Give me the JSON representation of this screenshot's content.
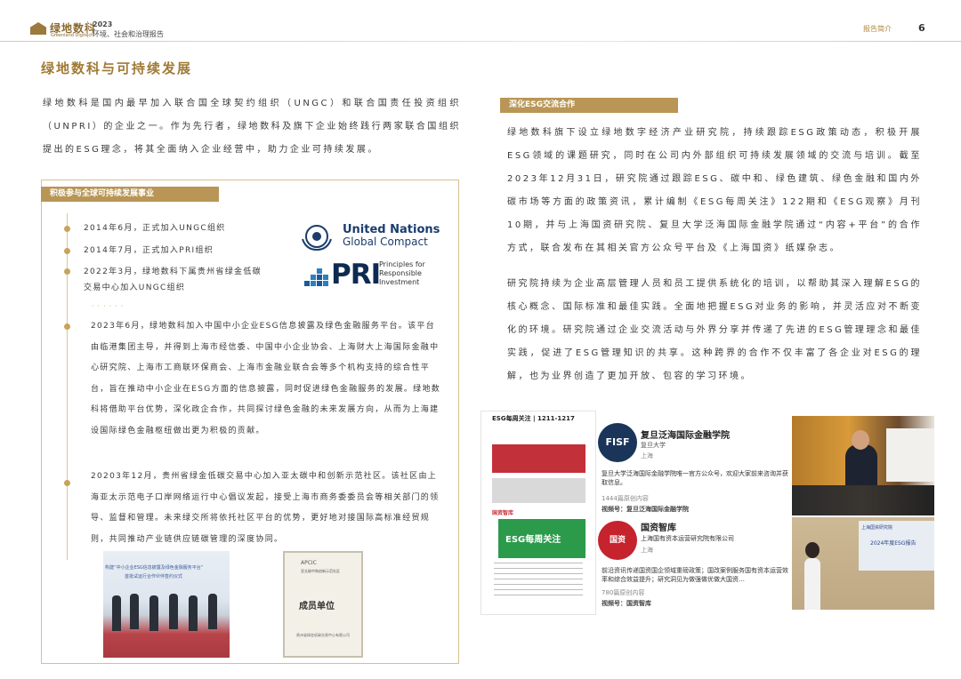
{
  "header": {
    "logo_cn": "绿地数科",
    "logo_en": "Greenland Digitech",
    "year": "2023",
    "report_title": "环境、社会和治理报告",
    "section": "报告简介",
    "page": "6"
  },
  "title": "绿地数科与可持续发展",
  "intro": "绿地数科是国内最早加入联合国全球契约组织（UNGC）和联合国责任投资组织（UNPRI）的企业之一。作为先行者，绿地数科及旗下企业始终践行两家联合国组织提出的ESG理念，将其全面纳入企业经营中，助力企业可持续发展。",
  "left_box": {
    "tag": "积极参与全球可持续发展事业",
    "timeline": [
      "2014年6月，正式加入UNGC组织",
      "2014年7月，正式加入PRI组织",
      "2022年3月，绿地数科下属贵州省绿金低碳",
      "交易中心加入UNGC组织"
    ],
    "dots": "······",
    "para1": "2023年6月，绿地数科加入中国中小企业ESG信息披露及绿色金融服务平台。该平台由临港集团主导，并得到上海市经信委、中国中小企业协会、上海财大上海国际金融中心研究院、上海市工商联环保商会、上海市金融业联合会等多个机构支持的综合性平台，旨在推动中小企业在ESG方面的信息披露，同时促进绿色金融服务的发展。绿地数科将借助平台优势，深化政企合作，共同探讨绿色金融的未来发展方向，从而为上海建设国际绿色金融枢纽做出更为积极的贡献。",
    "para2": "20203年12月，贵州省绿金低碳交易中心加入亚太碳中和创新示范社区。该社区由上海亚太示范电子口岸网络运行中心倡议发起，接受上海市商务委委员会等相关部门的领导、监督和管理。未来绿交所将依托社区平台的优势，更好地对接国际高标准经贸规则，共同推动产业链供应链碳管理的深度协同。",
    "ungc_line1": "United Nations",
    "ungc_line2": "Global Compact",
    "pri_word": "PRI",
    "pri_sub": [
      "Principles for",
      "Responsible",
      "Investment"
    ],
    "photo_caption1": "构建“中小企业ESG信息披露及绿色金融服务平台”",
    "photo_caption2": "首批试运行合作伙伴签约仪式",
    "cert_title": "APCIC",
    "cert_sub": "亚太碳中和创新示范社区",
    "cert_main": "成员单位",
    "cert_foot": "贵州省绿金低碳交易中心有限公司"
  },
  "right": {
    "tag": "深化ESG交流合作",
    "para1": "绿地数科旗下设立绿地数字经济产业研究院，持续跟踪ESG政策动态，积极开展ESG领域的课题研究，同时在公司内外部组织可持续发展领域的交流与培训。截至2023年12月31日，研究院通过跟踪ESG、碳中和、绿色建筑、绿色金融和国内外碳市场等方面的政策资讯，累计编制《ESG每周关注》122期和《ESG观察》月刊10期，并与上海国资研究院、复旦大学泛海国际金融学院通过“内容+平台”的合作方式，联合发布在其相关官方公众号平台及《上海国资》纸媒杂志。",
    "para2": "研究院持续为企业高层管理人员和员工提供系统化的培训，以帮助其深入理解ESG的核心概念、国际标准和最佳实践。全面地把握ESG对业务的影响，并灵活应对不断变化的环境。研究院通过企业交流活动与外界分享并传递了先进的ESG管理理念和最佳实践，促进了ESG管理知识的共享。这种跨界的合作不仅丰富了各企业对ESG的理解，也为业界创造了更加开放、包容的学习环境。"
  },
  "screens": {
    "s1_head": "ESG每周关注 | 1211-1217",
    "s1_badge": "国资智库",
    "s1_green": "ESG每周关注",
    "fisf_logo": "FISF",
    "s2_name": "复旦泛海国际金融学院",
    "s2_sub1": "复旦大学",
    "s2_sub2": "上海",
    "s2_desc": "复旦大学泛海国际金融学院唯一官方公众号，欢迎大家前来咨询并获取信息。",
    "s2_count": "1444篇原创内容",
    "s2_vid": "视频号：复旦泛海国际金融学院",
    "gzk_logo": "国资",
    "s2_name2": "国资智库",
    "s2_sub3": "上海国有资本运营研究院有限公司",
    "s2_sub4": "上海",
    "s2_desc2": "前沿资讯传递国资国企领域重磅政策；国改案例服务国有资本运营效率和综合效益提升；研究洞见为做强做优做大国资…",
    "s2_count2": "780篇原创内容",
    "s2_vid2": "视频号：国资智库",
    "ph3_t1": "上海国资研究院",
    "ph3_t2": "2024年度ESG报告"
  },
  "colors": {
    "accent_gold": "#b99656",
    "title_gold": "#a07a35",
    "box_border": "#d6c08f"
  }
}
